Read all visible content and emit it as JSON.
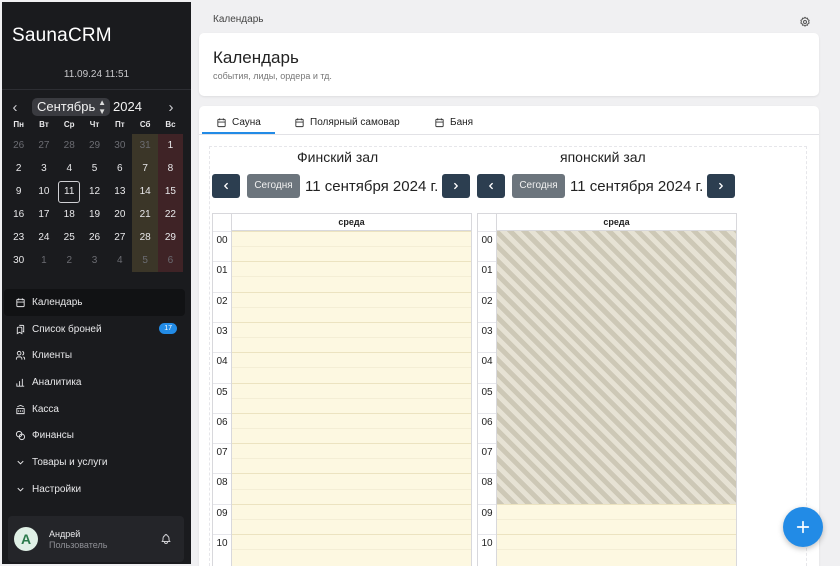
{
  "app": {
    "brand": "SaunaCRM",
    "datetime": "11.09.24 11:51"
  },
  "mini_calendar": {
    "month": "Сентябрь",
    "year": "2024",
    "weekdays": [
      "Пн",
      "Вт",
      "Ср",
      "Чт",
      "Пт",
      "Сб",
      "Вс"
    ],
    "days": [
      {
        "d": "26",
        "muted": true
      },
      {
        "d": "27",
        "muted": true
      },
      {
        "d": "28",
        "muted": true
      },
      {
        "d": "29",
        "muted": true
      },
      {
        "d": "30",
        "muted": true
      },
      {
        "d": "31",
        "muted": true
      },
      {
        "d": "1"
      },
      {
        "d": "2"
      },
      {
        "d": "3"
      },
      {
        "d": "4"
      },
      {
        "d": "5"
      },
      {
        "d": "6"
      },
      {
        "d": "7"
      },
      {
        "d": "8"
      },
      {
        "d": "9"
      },
      {
        "d": "10"
      },
      {
        "d": "11",
        "today": true
      },
      {
        "d": "12"
      },
      {
        "d": "13"
      },
      {
        "d": "14"
      },
      {
        "d": "15"
      },
      {
        "d": "16"
      },
      {
        "d": "17"
      },
      {
        "d": "18"
      },
      {
        "d": "19"
      },
      {
        "d": "20"
      },
      {
        "d": "21"
      },
      {
        "d": "22"
      },
      {
        "d": "23"
      },
      {
        "d": "24"
      },
      {
        "d": "25"
      },
      {
        "d": "26"
      },
      {
        "d": "27"
      },
      {
        "d": "28"
      },
      {
        "d": "29"
      },
      {
        "d": "30"
      },
      {
        "d": "1",
        "muted": true
      },
      {
        "d": "2",
        "muted": true
      },
      {
        "d": "3",
        "muted": true
      },
      {
        "d": "4",
        "muted": true
      },
      {
        "d": "5",
        "muted": true
      },
      {
        "d": "6",
        "muted": true
      }
    ]
  },
  "nav": {
    "items": [
      {
        "label": "Календарь",
        "icon": "calendar-icon",
        "active": true
      },
      {
        "label": "Список броней",
        "icon": "bookmarks-icon",
        "badge": "17"
      },
      {
        "label": "Клиенты",
        "icon": "users-icon"
      },
      {
        "label": "Аналитика",
        "icon": "chart-bar-icon"
      },
      {
        "label": "Касса",
        "icon": "building-bank-icon"
      },
      {
        "label": "Финансы",
        "icon": "coins-icon"
      },
      {
        "label": "Товары и услуги",
        "icon": "chevron-down-icon"
      },
      {
        "label": "Настройки",
        "icon": "chevron-down-icon"
      }
    ]
  },
  "user": {
    "initial": "А",
    "name": "Андрей",
    "role": "Пользователь"
  },
  "breadcrumb": "Календарь",
  "header": {
    "title": "Календарь",
    "subtitle": "события, лиды, ордера и тд."
  },
  "tabs": [
    {
      "label": "Сауна",
      "active": true
    },
    {
      "label": "Полярный самовар"
    },
    {
      "label": "Баня"
    }
  ],
  "halls": [
    {
      "title": "Финский зал",
      "today_label": "Сегодня",
      "date": "11 сентября 2024 г.",
      "day_header": "среда",
      "blocked_until_hour": 0
    },
    {
      "title": "японский зал",
      "today_label": "Сегодня",
      "date": "11 сентября 2024 г.",
      "day_header": "среда",
      "blocked_until_hour": 9
    }
  ],
  "hours": [
    "00",
    "01",
    "02",
    "03",
    "04",
    "05",
    "06",
    "07",
    "08",
    "09",
    "10"
  ],
  "colors": {
    "accent": "#228be6",
    "sidebar_bg": "#1a1b1e",
    "nav_button": "#2c3e50",
    "slot_bg": "#fdf8e1"
  }
}
